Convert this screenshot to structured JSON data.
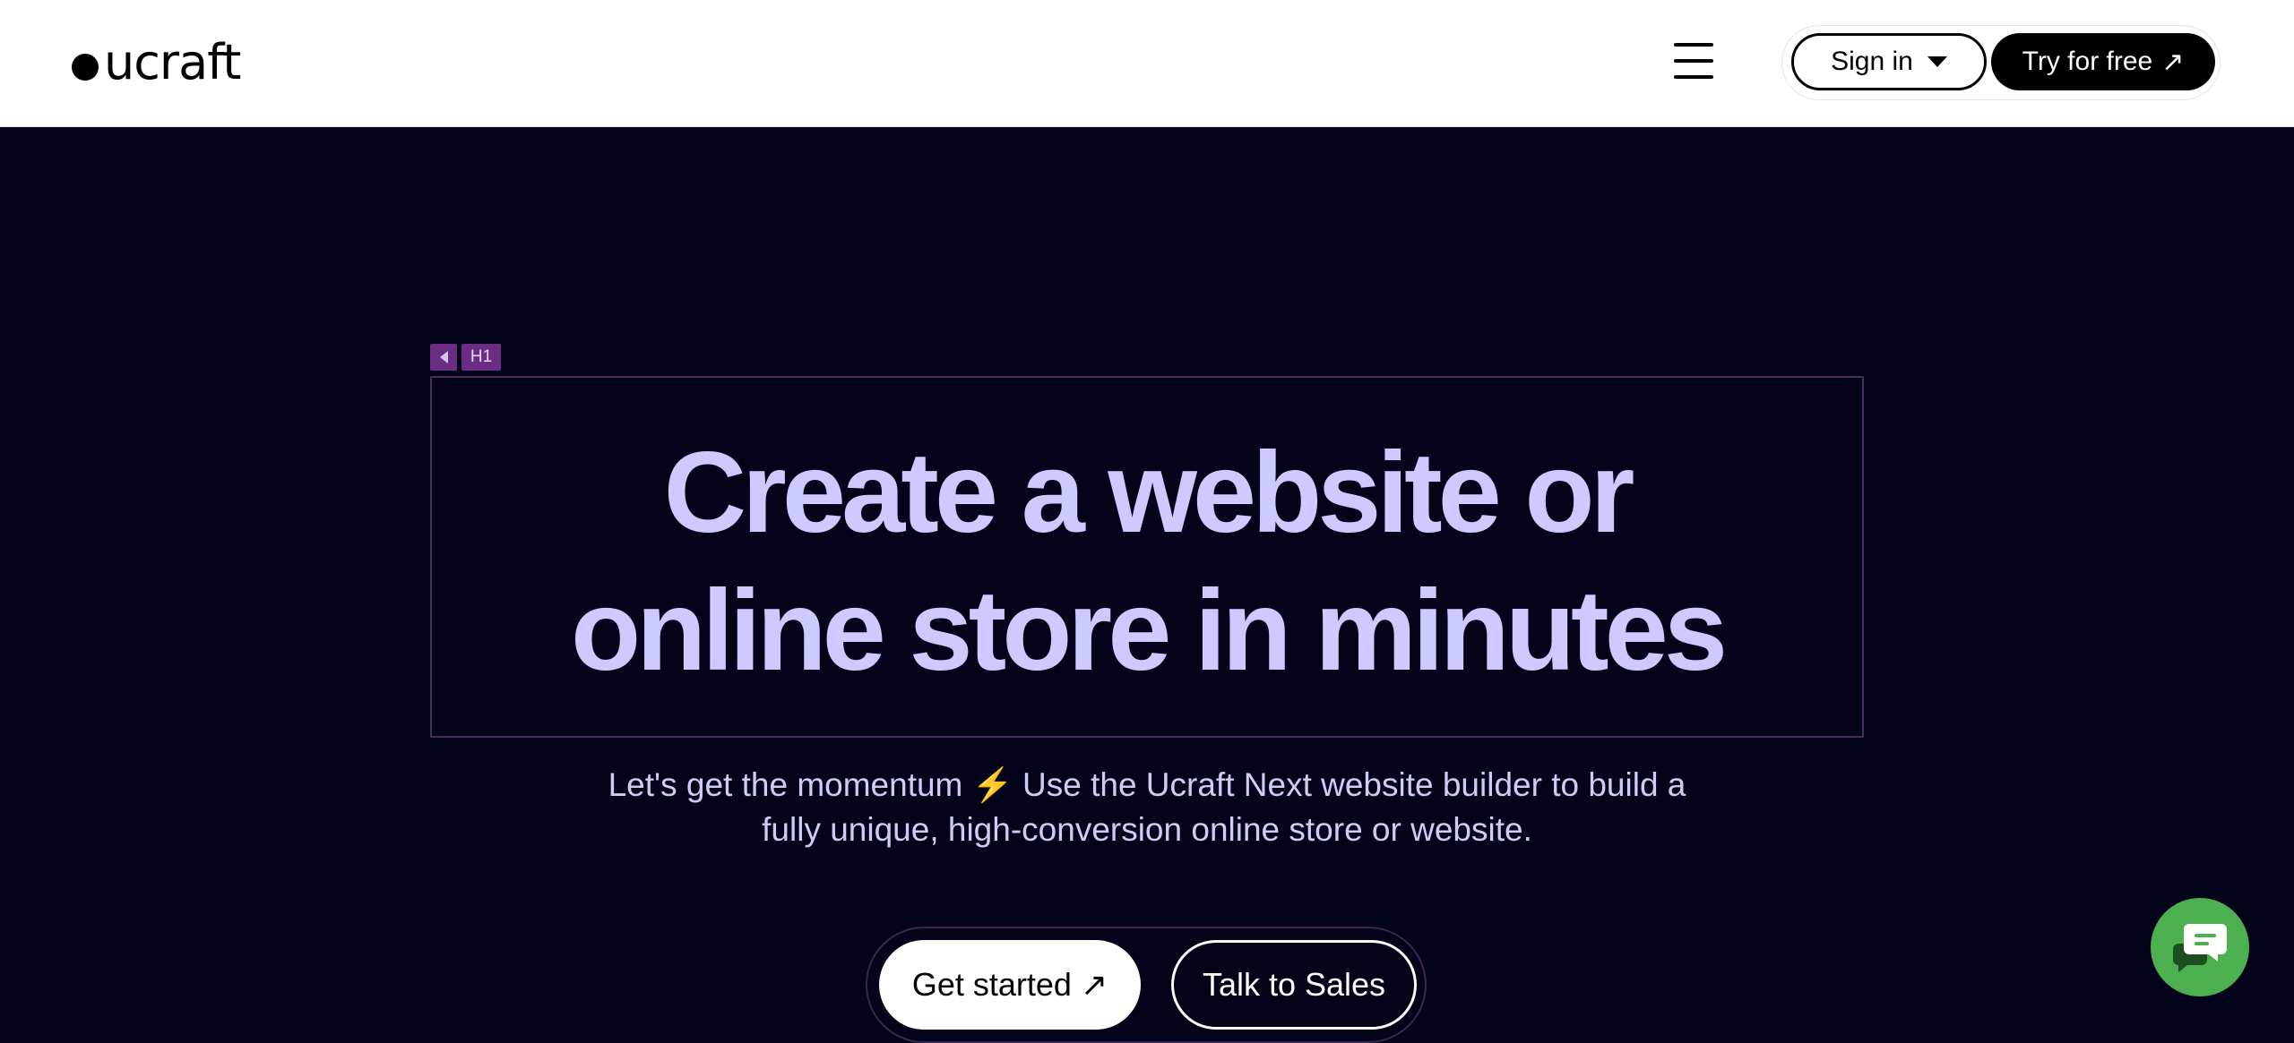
{
  "header": {
    "logo_text": "ucraft",
    "menu_icon": "hamburger-menu-icon",
    "signin_label": "Sign in",
    "try_label": "Try for free",
    "try_icon_glyph": "↗"
  },
  "hero": {
    "h1_tag": "H1",
    "headline_line1": "Create a website or",
    "headline_line2": "online store in minutes",
    "sub_line1_part1": "Let's get the momentum",
    "sub_bolt": "⚡",
    "sub_line1_part2": "Use the Ucraft Next website builder to build a",
    "sub_line2": "fully unique, high-conversion online store or website.",
    "cta_primary": "Get started",
    "cta_primary_icon": "↗",
    "cta_secondary": "Talk to Sales"
  },
  "chat": {
    "icon": "chat-bubble-icon"
  },
  "colors": {
    "background": "#03031a",
    "headline": "#cccaff",
    "subtext": "#cfcdf5",
    "chat": "#4caf50",
    "h1_tag": "#6b2d84"
  }
}
